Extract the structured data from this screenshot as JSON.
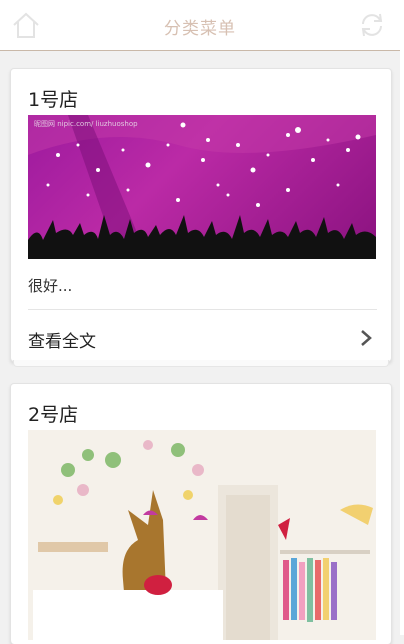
{
  "header": {
    "title": "分类菜单",
    "home_icon": "home-icon",
    "refresh_icon": "refresh-icon"
  },
  "cards": [
    {
      "title": "1号店",
      "image_desc_icon": "concert-crowd-image",
      "watermark": "昵图网 nipic.com/ liuzhuoshop",
      "excerpt": "很好...",
      "read_more": "查看全文",
      "chevron_icon": "chevron-right-icon"
    },
    {
      "title": "2号店",
      "image_desc_icon": "store-interior-image"
    }
  ],
  "colors": {
    "header_title": "#d7c0b2",
    "background": "#f1f1f1",
    "card": "#ffffff"
  }
}
